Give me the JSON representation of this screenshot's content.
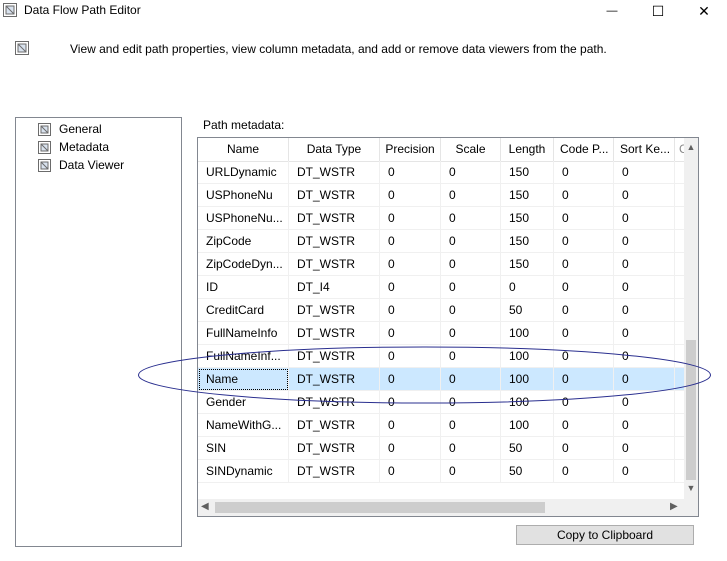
{
  "window": {
    "title": "Data Flow Path Editor",
    "min_glyph": "—",
    "max_glyph": "☐",
    "close_glyph": "✕"
  },
  "header": {
    "description": "View and edit path properties, view column metadata, and add or remove data viewers from the path."
  },
  "nav": {
    "items": [
      {
        "label": "General",
        "icon": "page-icon"
      },
      {
        "label": "Metadata",
        "icon": "page-icon"
      },
      {
        "label": "Data Viewer",
        "icon": "page-icon"
      }
    ]
  },
  "metadata": {
    "label": "Path metadata:",
    "columns": [
      "Name",
      "Data Type",
      "Precision",
      "Scale",
      "Length",
      "Code P...",
      "Sort Ke...",
      "C"
    ],
    "rows": [
      [
        "URLDynamic",
        "DT_WSTR",
        "0",
        "0",
        "150",
        "0",
        "0"
      ],
      [
        "USPhoneNu",
        "DT_WSTR",
        "0",
        "0",
        "150",
        "0",
        "0"
      ],
      [
        "USPhoneNu...",
        "DT_WSTR",
        "0",
        "0",
        "150",
        "0",
        "0"
      ],
      [
        "ZipCode",
        "DT_WSTR",
        "0",
        "0",
        "150",
        "0",
        "0"
      ],
      [
        "ZipCodeDyn...",
        "DT_WSTR",
        "0",
        "0",
        "150",
        "0",
        "0"
      ],
      [
        "ID",
        "DT_I4",
        "0",
        "0",
        "0",
        "0",
        "0"
      ],
      [
        "CreditCard",
        "DT_WSTR",
        "0",
        "0",
        "50",
        "0",
        "0"
      ],
      [
        "FullNameInfo",
        "DT_WSTR",
        "0",
        "0",
        "100",
        "0",
        "0"
      ],
      [
        "FullNameInf...",
        "DT_WSTR",
        "0",
        "0",
        "100",
        "0",
        "0"
      ],
      [
        "Name",
        "DT_WSTR",
        "0",
        "0",
        "100",
        "0",
        "0"
      ],
      [
        "Gender",
        "DT_WSTR",
        "0",
        "0",
        "100",
        "0",
        "0"
      ],
      [
        "NameWithG...",
        "DT_WSTR",
        "0",
        "0",
        "100",
        "0",
        "0"
      ],
      [
        "SIN",
        "DT_WSTR",
        "0",
        "0",
        "50",
        "0",
        "0"
      ],
      [
        "SINDynamic",
        "DT_WSTR",
        "0",
        "0",
        "50",
        "0",
        "0"
      ]
    ],
    "selected_row": 9,
    "scroll_up_glyph": "▲",
    "scroll_down_glyph": "▼",
    "scroll_left_glyph": "◀",
    "scroll_right_glyph": "▶"
  },
  "buttons": {
    "copy": "Copy to Clipboard"
  },
  "colors": {
    "selection": "#cce8ff",
    "annotation": "#2a2f8f"
  }
}
